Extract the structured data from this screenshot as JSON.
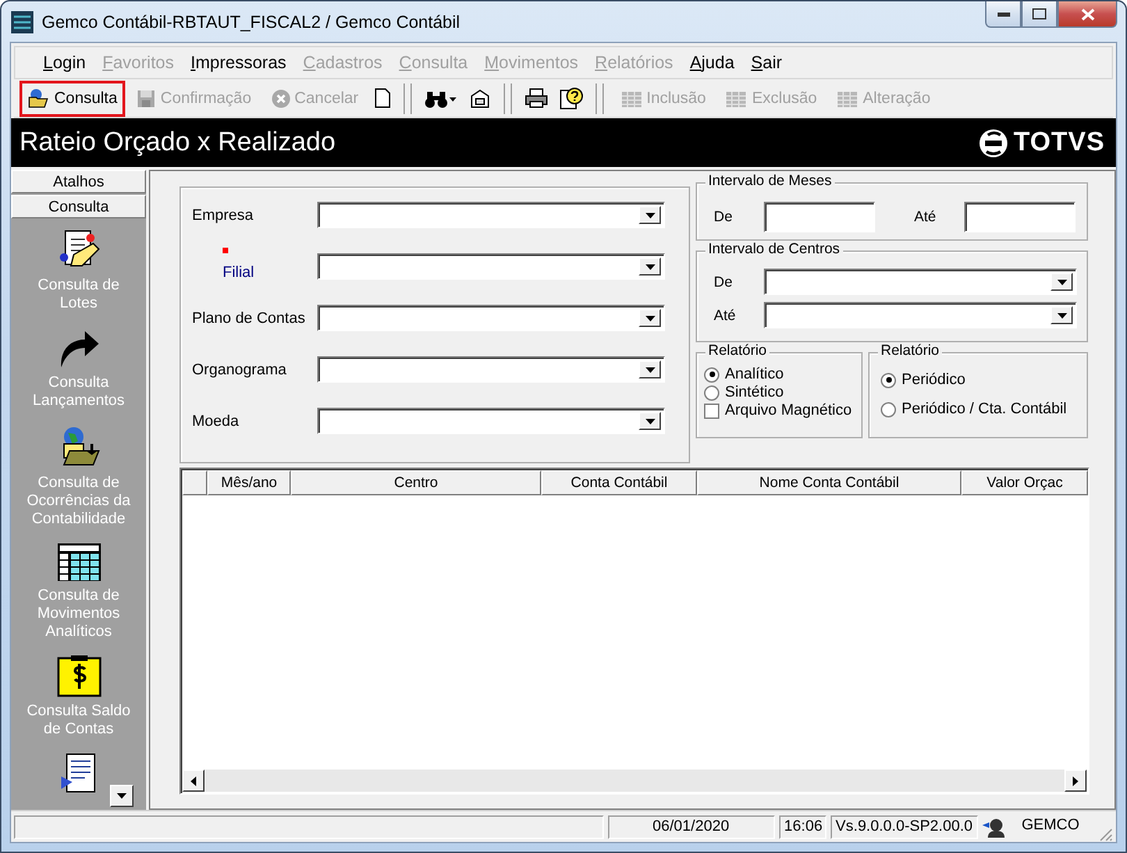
{
  "window": {
    "title": "Gemco Contábil-RBTAUT_FISCAL2 / Gemco Contábil"
  },
  "menu": [
    {
      "label": "Login",
      "disabled": false
    },
    {
      "label": "Favoritos",
      "disabled": true
    },
    {
      "label": "Impressoras",
      "disabled": false
    },
    {
      "label": "Cadastros",
      "disabled": true
    },
    {
      "label": "Consulta",
      "disabled": true
    },
    {
      "label": "Movimentos",
      "disabled": true
    },
    {
      "label": "Relatórios",
      "disabled": true
    },
    {
      "label": "Ajuda",
      "disabled": false
    },
    {
      "label": "Sair",
      "disabled": false
    }
  ],
  "toolbar": [
    {
      "kind": "open",
      "label": "Consulta",
      "disabled": false,
      "highlighted": true
    },
    {
      "kind": "save",
      "label": "Confirmação",
      "disabled": true,
      "highlighted": false
    },
    {
      "kind": "cancel",
      "label": "Cancelar",
      "disabled": true,
      "highlighted": false
    },
    {
      "kind": "tools"
    },
    {
      "kind": "separator"
    },
    {
      "kind": "record",
      "label": "Inclusão",
      "disabled": true,
      "highlighted": false
    },
    {
      "kind": "record",
      "label": "Exclusão",
      "disabled": true,
      "highlighted": false
    },
    {
      "kind": "record",
      "label": "Alteração",
      "disabled": true,
      "highlighted": false
    }
  ],
  "header": {
    "title": "Rateio Orçado x Realizado",
    "logo": "TOTVS"
  },
  "sidebar": {
    "tabs": [
      {
        "label": "Atalhos"
      },
      {
        "label": "Consulta"
      }
    ],
    "items": [
      {
        "kind": "lotes",
        "label": "Consulta de Lotes"
      },
      {
        "kind": "arrow",
        "label": "Consulta Lançamentos"
      },
      {
        "kind": "folder",
        "label": "Consulta de Ocorrências da Contabilidade"
      },
      {
        "kind": "grid",
        "label": "Consulta de Movimentos Analíticos"
      },
      {
        "kind": "dollar",
        "label": "Consulta Saldo de Contas"
      },
      {
        "kind": "document"
      }
    ]
  },
  "form": {
    "fields": [
      {
        "label": "Empresa",
        "required": false
      },
      {
        "label": "Filial",
        "required": true
      },
      {
        "label": "Plano de Contas",
        "required": false
      },
      {
        "label": "Organograma",
        "required": false
      },
      {
        "label": "Moeda",
        "required": false
      }
    ],
    "months": {
      "title": "Intervalo de Meses",
      "from_label": "De",
      "to_label": "Até"
    },
    "centers": {
      "title": "Intervalo de Centros",
      "from_label": "De",
      "to_label": "Até"
    },
    "report_type": {
      "title": "Relatório",
      "options": [
        {
          "label": "Analítico",
          "selected": true
        },
        {
          "label": "Sintético",
          "selected": false
        }
      ],
      "checkbox": {
        "label": "Arquivo Magnético",
        "checked": false
      }
    },
    "report_mode": {
      "title": "Relatório",
      "options": [
        {
          "label": "Periódico",
          "selected": true
        },
        {
          "label": "Periódico / Cta. Contábil",
          "selected": false
        }
      ]
    }
  },
  "table": {
    "columns": [
      "Mês/ano",
      "Centro",
      "Conta Contábil",
      "Nome Conta Contábil",
      "Valor Orçac"
    ]
  },
  "status_bar": {
    "date": "06/01/2020",
    "time": "16:06",
    "version": "Vs.9.0.0.0-SP2.00.0",
    "user": "GEMCO"
  }
}
